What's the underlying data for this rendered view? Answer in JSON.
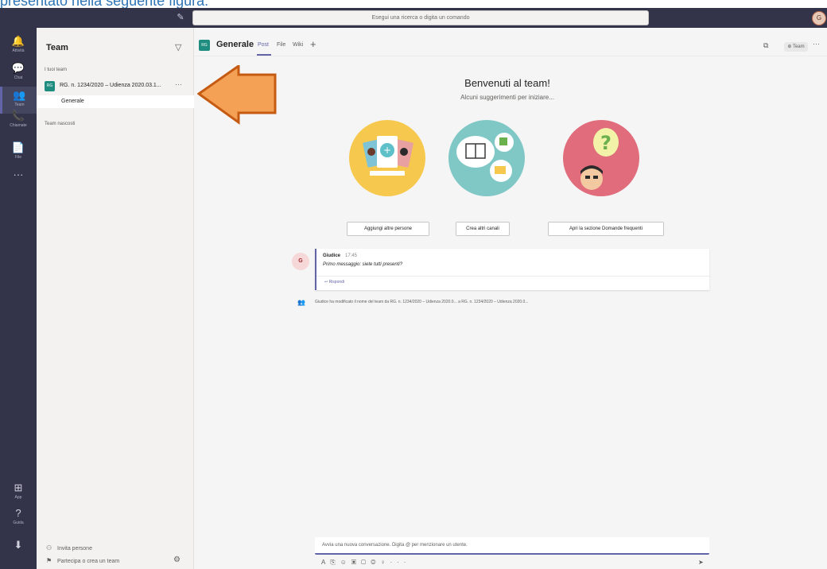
{
  "caption": "presentato nella seguente figura:",
  "titlebar": {
    "search_placeholder": "Esegui una ricerca o digita un comando",
    "user_initials": "G"
  },
  "rail": {
    "items": [
      {
        "label": "Attività",
        "icon": "bell-icon",
        "glyph": "🔔"
      },
      {
        "label": "Chat",
        "icon": "chat-icon",
        "glyph": "💬"
      },
      {
        "label": "Team",
        "icon": "teams-icon",
        "glyph": "👥"
      },
      {
        "label": "Chiamate",
        "icon": "phone-icon",
        "glyph": "📞"
      },
      {
        "label": "File",
        "icon": "file-icon",
        "glyph": "📄"
      },
      {
        "label": "",
        "icon": "more-icon",
        "glyph": "···"
      }
    ],
    "bottom_items": [
      {
        "label": "App",
        "icon": "apps-icon",
        "glyph": "⊞"
      },
      {
        "label": "Guida",
        "icon": "help-icon",
        "glyph": "?"
      },
      {
        "label": "",
        "icon": "download-icon",
        "glyph": "⬇"
      }
    ]
  },
  "sidepanel": {
    "title": "Team",
    "your_teams_label": "I tuoi team",
    "team": {
      "initials": "RG",
      "name": "RG. n. 1234/2020 – Udienza 2020.03.1...",
      "more": "···"
    },
    "channel": "Generale",
    "hidden_teams_label": "Team nascosti",
    "invite_label": "Invita persone",
    "join_label": "Partecipa o crea un team"
  },
  "channel_header": {
    "initials": "RG",
    "name": "Generale",
    "tabs": [
      "Post",
      "File",
      "Wiki"
    ],
    "team_button": "⊕ Team",
    "more": "···"
  },
  "welcome": {
    "title": "Benvenuti al team!",
    "subtitle": "Alcuni suggerimenti per iniziare...",
    "actions": [
      "Aggiungi altre persone",
      "Crea altri canali",
      "Apri la sezione Domande frequenti"
    ]
  },
  "message": {
    "author_initial": "G",
    "author": "Giudice",
    "time": "17:45",
    "text": "Primo messaggio: siete tutti presenti?",
    "reply": "↩ Rispondi"
  },
  "system_message": "Giudice ha modificato il nome del team da RG. n. 1234/2020 – Udienza 2020.0... a RG. n. 1234/2020 – Udienza 2020.0...",
  "composer": {
    "placeholder": "Avvia una nuova conversazione. Digita @ per menzionare un utente."
  },
  "colors": {
    "rail": "#33344a",
    "accent": "#6264a7",
    "team_avatar": "#1e8c7e",
    "arrow": "#f4a156"
  }
}
